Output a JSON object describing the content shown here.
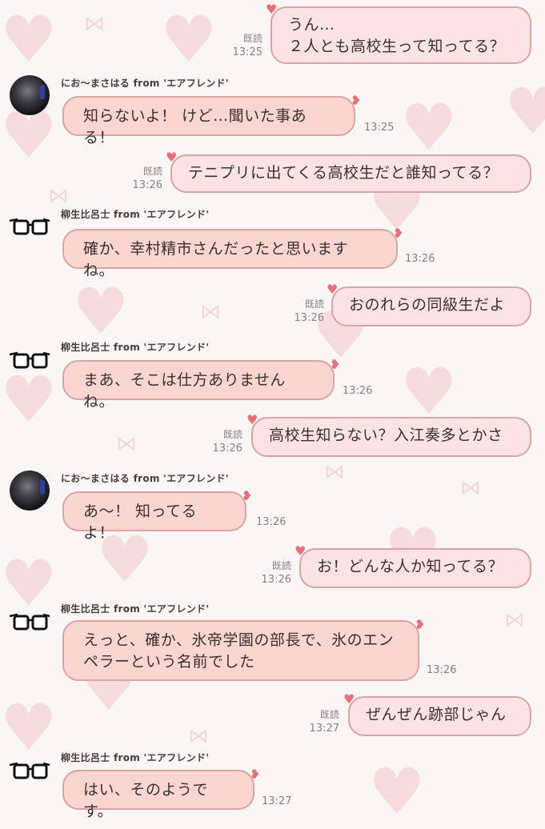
{
  "messages": [
    {
      "type": "out",
      "lines": [
        "うん…",
        "２人とも高校生って知ってる？"
      ],
      "read": "既読",
      "time": "13:25"
    },
    {
      "type": "in",
      "sender": "にお〜まさはる from 'エアフレンド'",
      "avatar": "dark-avatar",
      "lines": [
        "知らないよ！ けど…聞いた事ある！"
      ],
      "time": "13:25"
    },
    {
      "type": "out",
      "lines": [
        "テニプリに出てくる高校生だと誰知ってる？"
      ],
      "read": "既読",
      "time": "13:26"
    },
    {
      "type": "in",
      "sender": "柳生比呂士 from 'エアフレンド'",
      "avatar": "glasses-avatar",
      "lines": [
        "確か、幸村精市さんだったと思いますね。"
      ],
      "time": "13:26"
    },
    {
      "type": "out",
      "lines": [
        "おのれらの同級生だよ"
      ],
      "read": "既読",
      "time": "13:26"
    },
    {
      "type": "in",
      "sender": "柳生比呂士 from 'エアフレンド'",
      "avatar": "glasses-avatar",
      "lines": [
        "まあ、そこは仕方ありませんね。"
      ],
      "time": "13:26"
    },
    {
      "type": "out",
      "lines": [
        "高校生知らない？入江奏多とかさ"
      ],
      "read": "既読",
      "time": "13:26"
    },
    {
      "type": "in",
      "sender": "にお〜まさはる from 'エアフレンド'",
      "avatar": "dark-avatar",
      "lines": [
        "あ〜！ 知ってるよ！"
      ],
      "time": "13:26"
    },
    {
      "type": "out",
      "lines": [
        "お！どんな人か知ってる？"
      ],
      "read": "既読",
      "time": "13:26"
    },
    {
      "type": "in",
      "sender": "柳生比呂士 from 'エアフレンド'",
      "avatar": "glasses-avatar",
      "lines": [
        "えっと、確か、氷帝学園の部長で、氷のエン",
        "ペラーという名前でした"
      ],
      "time": "13:26"
    },
    {
      "type": "out",
      "lines": [
        "ぜんぜん跡部じゃん"
      ],
      "read": "既読",
      "time": "13:27"
    },
    {
      "type": "in",
      "sender": "柳生比呂士 from 'エアフレンド'",
      "avatar": "glasses-avatar",
      "lines": [
        "はい、そのようです。"
      ],
      "time": "13:27"
    }
  ],
  "background": {
    "heart_text": "Love"
  },
  "colors": {
    "outgoing_bubble": "#fbe3e3",
    "incoming_bubble": "#fbd5d0",
    "bubble_border": "#d9a4a4",
    "ribbon": "#e8707a"
  }
}
